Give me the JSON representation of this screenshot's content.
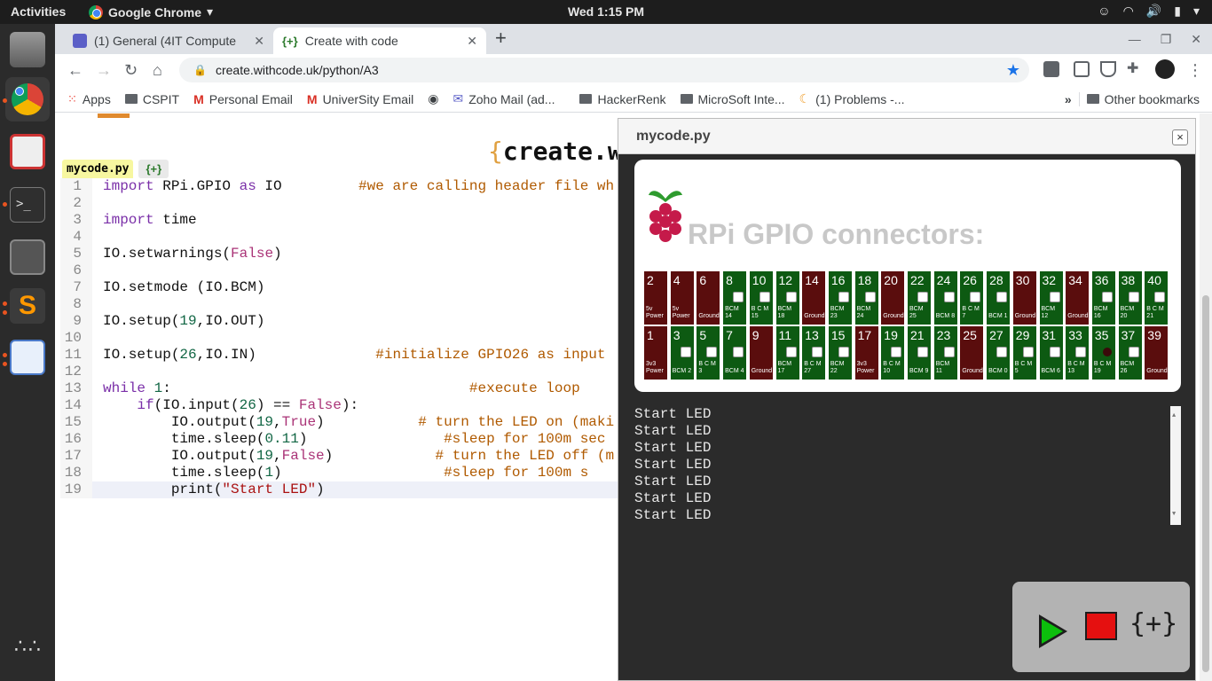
{
  "topbar": {
    "activities": "Activities",
    "app_name": "Google Chrome",
    "clock": "Wed  1:15 PM"
  },
  "tabs": [
    {
      "title": "(1) General (4IT Computer"
    },
    {
      "title": "Create with code"
    }
  ],
  "address": {
    "url": "create.withcode.uk/python/A3"
  },
  "bookmarks": {
    "apps": "Apps",
    "items": [
      "CSPIT",
      "Personal Email",
      "UniverSity Email",
      "Zoho Mail (ad...",
      "HackerRenk",
      "MicroSoft Inte...",
      "(1) Problems -..."
    ],
    "more": "»",
    "other": "Other bookmarks"
  },
  "site": {
    "title_brace": "{",
    "title_text": "create.wi"
  },
  "editor": {
    "file_tab": "mycode.py",
    "format_tab": "{+}",
    "lines": [
      {
        "n": "1"
      },
      {
        "n": "2"
      },
      {
        "n": "3"
      },
      {
        "n": "4"
      },
      {
        "n": "5"
      },
      {
        "n": "6"
      },
      {
        "n": "7"
      },
      {
        "n": "8"
      },
      {
        "n": "9"
      },
      {
        "n": "10"
      },
      {
        "n": "11"
      },
      {
        "n": "12"
      },
      {
        "n": "13"
      },
      {
        "n": "14"
      },
      {
        "n": "15"
      },
      {
        "n": "16"
      },
      {
        "n": "17"
      },
      {
        "n": "18"
      },
      {
        "n": "19"
      }
    ],
    "tokens": {
      "l1a": "import",
      "l1b": " RPi.GPIO ",
      "l1c": "as",
      "l1d": " IO         ",
      "l1e": "#we are calling header file wh",
      "l3a": "import",
      "l3b": " time",
      "l5a": "IO.setwarnings(",
      "l5b": "False",
      "l5c": ")",
      "l7": "IO.setmode (IO.BCM)",
      "l9a": "IO.setup(",
      "l9b": "19",
      "l9c": ",IO.OUT)",
      "l11a": "IO.setup(",
      "l11b": "26",
      "l11c": ",IO.IN)              ",
      "l11d": "#initialize GPIO26 as input",
      "l13a": "while",
      "l13b": " ",
      "l13c": "1",
      "l13d": ":                                   ",
      "l13e": "#execute loop",
      "l14a": "    ",
      "l14b": "if",
      "l14c": "(IO.input(",
      "l14d": "26",
      "l14e": ") == ",
      "l14f": "False",
      "l14g": "):",
      "l15a": "        IO.output(",
      "l15b": "19",
      "l15c": ",",
      "l15d": "True",
      "l15e": ")           ",
      "l15f": "# turn the LED on (maki",
      "l16a": "        time.sleep(",
      "l16b": "0.11",
      "l16c": ")                ",
      "l16d": "#sleep for 100m sec",
      "l17a": "        IO.output(",
      "l17b": "19",
      "l17c": ",",
      "l17d": "False",
      "l17e": ")            ",
      "l17f": "# turn the LED off (m",
      "l18a": "        time.sleep(",
      "l18b": "1",
      "l18c": ")                   ",
      "l18d": "#sleep for 100m s",
      "l19a": "        print(",
      "l19b": "\"Start LED\"",
      "l19c": ")"
    }
  },
  "modal": {
    "title": "mycode.py",
    "close": "×",
    "gpio_title": "RPi GPIO connectors:",
    "top_pins": [
      {
        "num": "2",
        "label": "5v Power",
        "type": "power"
      },
      {
        "num": "4",
        "label": "5v Power",
        "type": "power"
      },
      {
        "num": "6",
        "label": "Ground",
        "type": "power"
      },
      {
        "num": "8",
        "label": "BCM 14",
        "type": "gpio"
      },
      {
        "num": "10",
        "label": "B C M 15",
        "type": "gpio"
      },
      {
        "num": "12",
        "label": "BCM 18",
        "type": "gpio"
      },
      {
        "num": "14",
        "label": "Ground",
        "type": "power"
      },
      {
        "num": "16",
        "label": "BCM 23",
        "type": "gpio"
      },
      {
        "num": "18",
        "label": "BCM 24",
        "type": "gpio"
      },
      {
        "num": "20",
        "label": "Ground",
        "type": "power"
      },
      {
        "num": "22",
        "label": "BCM 25",
        "type": "gpio"
      },
      {
        "num": "24",
        "label": "BCM 8",
        "type": "gpio"
      },
      {
        "num": "26",
        "label": "B C M 7",
        "type": "gpio"
      },
      {
        "num": "28",
        "label": "BCM 1",
        "type": "gpio"
      },
      {
        "num": "30",
        "label": "Ground",
        "type": "power"
      },
      {
        "num": "32",
        "label": "BCM 12",
        "type": "gpio"
      },
      {
        "num": "34",
        "label": "Ground",
        "type": "power"
      },
      {
        "num": "36",
        "label": "BCM 16",
        "type": "gpio"
      },
      {
        "num": "38",
        "label": "BCM 20",
        "type": "gpio"
      },
      {
        "num": "40",
        "label": "B C M 21",
        "type": "gpio"
      }
    ],
    "bottom_pins": [
      {
        "num": "1",
        "label": "3v3 Power",
        "type": "power"
      },
      {
        "num": "3",
        "label": "BCM 2",
        "type": "gpio"
      },
      {
        "num": "5",
        "label": "B C M 3",
        "type": "gpio"
      },
      {
        "num": "7",
        "label": "BCM 4",
        "type": "gpio"
      },
      {
        "num": "9",
        "label": "Ground",
        "type": "power"
      },
      {
        "num": "11",
        "label": "BCM 17",
        "type": "gpio"
      },
      {
        "num": "13",
        "label": "B C M 27",
        "type": "gpio"
      },
      {
        "num": "15",
        "label": "BCM 22",
        "type": "gpio"
      },
      {
        "num": "17",
        "label": "3v3 Power",
        "type": "power"
      },
      {
        "num": "19",
        "label": "B C M 10",
        "type": "gpio"
      },
      {
        "num": "21",
        "label": "BCM 9",
        "type": "gpio"
      },
      {
        "num": "23",
        "label": "BCM 11",
        "type": "gpio"
      },
      {
        "num": "25",
        "label": "Ground",
        "type": "power"
      },
      {
        "num": "27",
        "label": "BCM 0",
        "type": "gpio"
      },
      {
        "num": "29",
        "label": "B C M 5",
        "type": "gpio"
      },
      {
        "num": "31",
        "label": "BCM 6",
        "type": "gpio"
      },
      {
        "num": "33",
        "label": "B C M 13",
        "type": "gpio"
      },
      {
        "num": "35",
        "label": "B C M 19",
        "type": "gpio",
        "led": true
      },
      {
        "num": "37",
        "label": "BCM 26",
        "type": "gpio"
      },
      {
        "num": "39",
        "label": "Ground",
        "type": "power"
      }
    ],
    "console_lines": [
      "Start LED",
      "Start LED",
      "Start LED",
      "Start LED",
      "Start LED",
      "Start LED",
      "Start LED"
    ],
    "controls": {
      "format_label": "{+}"
    }
  },
  "colors": {
    "power_pin": "#5a0d0d",
    "gpio_pin": "#0d5a12",
    "accent_green": "#0cbf0c",
    "stop_red": "#e51010"
  }
}
